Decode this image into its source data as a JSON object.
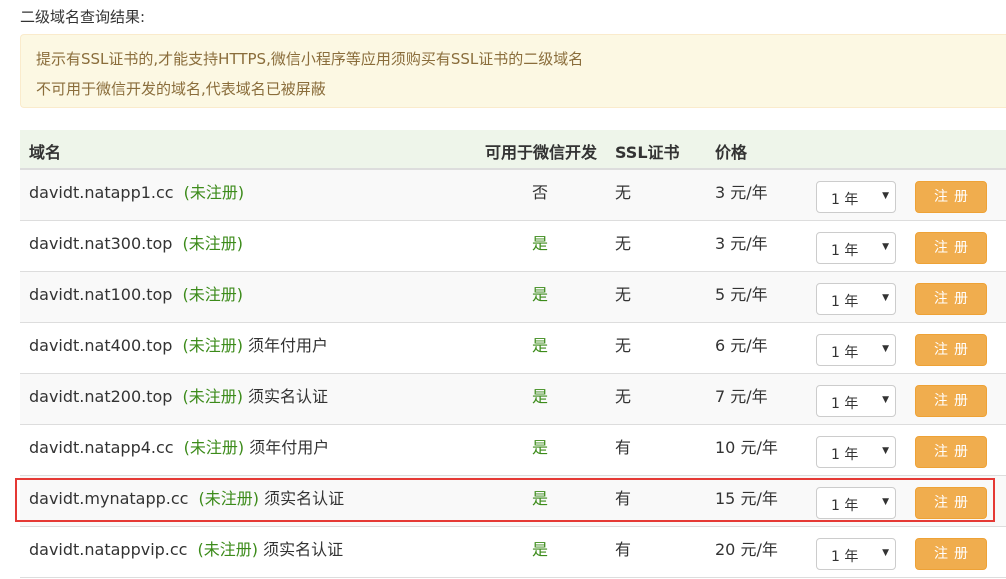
{
  "page": {
    "title": "二级域名查询结果:"
  },
  "alert": {
    "line1": "提示有SSL证书的,才能支持HTTPS,微信小程序等应用须购买有SSL证书的二级域名",
    "line2": "不可用于微信开发的域名,代表域名已被屏蔽"
  },
  "table": {
    "headers": {
      "domain": "域名",
      "wechat": "可用于微信开发",
      "ssl": "SSL证书",
      "price": "价格"
    },
    "rows": [
      {
        "domain": "davidt.natapp1.cc",
        "status": "(未注册)",
        "note": "",
        "wechat": "否",
        "wechat_ok": false,
        "ssl": "无",
        "price": "3 元/年",
        "period": "1 年",
        "button": "注册"
      },
      {
        "domain": "davidt.nat300.top",
        "status": "(未注册)",
        "note": "",
        "wechat": "是",
        "wechat_ok": true,
        "ssl": "无",
        "price": "3 元/年",
        "period": "1 年",
        "button": "注册"
      },
      {
        "domain": "davidt.nat100.top",
        "status": "(未注册)",
        "note": "",
        "wechat": "是",
        "wechat_ok": true,
        "ssl": "无",
        "price": "5 元/年",
        "period": "1 年",
        "button": "注册"
      },
      {
        "domain": "davidt.nat400.top",
        "status": "(未注册)",
        "note": "须年付用户",
        "wechat": "是",
        "wechat_ok": true,
        "ssl": "无",
        "price": "6 元/年",
        "period": "1 年",
        "button": "注册"
      },
      {
        "domain": "davidt.nat200.top",
        "status": "(未注册)",
        "note": "须实名认证",
        "wechat": "是",
        "wechat_ok": true,
        "ssl": "无",
        "price": "7 元/年",
        "period": "1 年",
        "button": "注册"
      },
      {
        "domain": "davidt.natapp4.cc",
        "status": "(未注册)",
        "note": "须年付用户",
        "wechat": "是",
        "wechat_ok": true,
        "ssl": "有",
        "price": "10 元/年",
        "period": "1 年",
        "button": "注册"
      },
      {
        "domain": "davidt.mynatapp.cc",
        "status": "(未注册)",
        "note": "须实名认证",
        "wechat": "是",
        "wechat_ok": true,
        "ssl": "有",
        "price": "15 元/年",
        "period": "1 年",
        "button": "注册"
      },
      {
        "domain": "davidt.natappvip.cc",
        "status": "(未注册)",
        "note": "须实名认证",
        "wechat": "是",
        "wechat_ok": true,
        "ssl": "有",
        "price": "20 元/年",
        "period": "1 年",
        "button": "注册"
      }
    ]
  },
  "colors": {
    "accent_button": "#f0ad4e",
    "status_green": "#3c8b1a",
    "highlight_box": "#e53935",
    "alert_bg": "#fcf8e3"
  },
  "icons": {
    "select_arrow": "caret-down-icon"
  }
}
